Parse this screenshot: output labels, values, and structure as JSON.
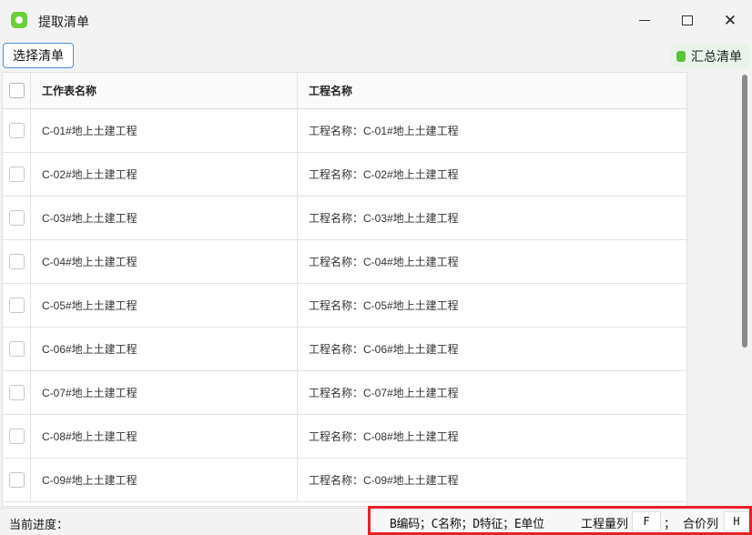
{
  "window": {
    "title": "提取清单",
    "app_icon": "app-logo-icon",
    "controls": {
      "minimize": "minimize-icon",
      "maximize": "maximize-icon",
      "close": "close-icon"
    }
  },
  "toolbar": {
    "select_label": "选择清单",
    "summary_label": "汇总清单"
  },
  "table": {
    "headers": {
      "sheet_name": "工作表名称",
      "project_name": "工程名称"
    },
    "rows": [
      {
        "sheet_name": "C-01#地上土建工程",
        "project_name": "工程名称：C-01#地上土建工程"
      },
      {
        "sheet_name": "C-02#地上土建工程",
        "project_name": "工程名称：C-02#地上土建工程"
      },
      {
        "sheet_name": "C-03#地上土建工程",
        "project_name": "工程名称：C-03#地上土建工程"
      },
      {
        "sheet_name": "C-04#地上土建工程",
        "project_name": "工程名称：C-04#地上土建工程"
      },
      {
        "sheet_name": "C-05#地上土建工程",
        "project_name": "工程名称：C-05#地上土建工程"
      },
      {
        "sheet_name": "C-06#地上土建工程",
        "project_name": "工程名称：C-06#地上土建工程"
      },
      {
        "sheet_name": "C-07#地上土建工程",
        "project_name": "工程名称：C-07#地上土建工程"
      },
      {
        "sheet_name": "C-08#地上土建工程",
        "project_name": "工程名称：C-08#地上土建工程"
      },
      {
        "sheet_name": "C-09#地上土建工程",
        "project_name": "工程名称：C-09#地上土建工程"
      }
    ]
  },
  "status": {
    "progress_label": "当前进度：",
    "column_legend": "B编码；C名称；D特征；E单位",
    "quantity_label": "工程量列",
    "quantity_value": "F",
    "separator": "；",
    "price_label": "合价列",
    "price_value": "H"
  },
  "colors": {
    "accent_border": "#4a90d9",
    "highlight_red": "#e8202a",
    "app_green": "#6ccf3a"
  }
}
